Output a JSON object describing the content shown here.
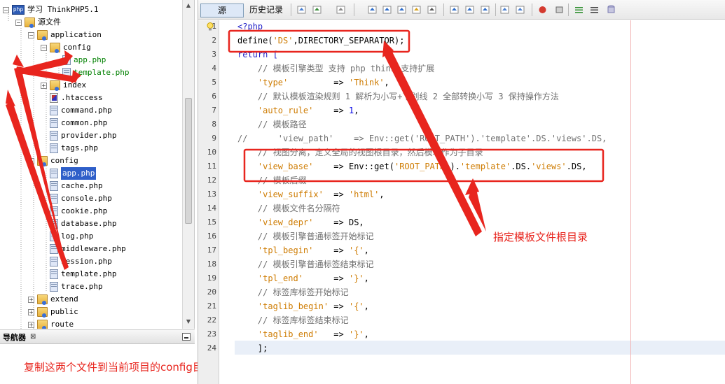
{
  "tree": {
    "project": "学习 ThinkPHP5.1",
    "project_icon": "php",
    "items": [
      {
        "label": "源文件",
        "kind": "folder",
        "level": 1
      },
      {
        "label": "application",
        "kind": "folder",
        "level": 2
      },
      {
        "label": "config",
        "kind": "folder",
        "level": 3
      },
      {
        "label": "app.php",
        "kind": "php",
        "level": 4,
        "green": true
      },
      {
        "label": "template.php",
        "kind": "php",
        "level": 4,
        "green": true
      },
      {
        "label": "index",
        "kind": "folder",
        "level": 3
      },
      {
        "label": ".htaccess",
        "kind": "htaccess",
        "level": 3
      },
      {
        "label": "command.php",
        "kind": "php",
        "level": 3
      },
      {
        "label": "common.php",
        "kind": "php",
        "level": 3
      },
      {
        "label": "provider.php",
        "kind": "php",
        "level": 3
      },
      {
        "label": "tags.php",
        "kind": "php",
        "level": 3
      },
      {
        "label": "config",
        "kind": "folder",
        "level": 2
      },
      {
        "label": "app.php",
        "kind": "php",
        "level": 3,
        "selected": true
      },
      {
        "label": "cache.php",
        "kind": "php",
        "level": 3
      },
      {
        "label": "console.php",
        "kind": "php",
        "level": 3
      },
      {
        "label": "cookie.php",
        "kind": "php",
        "level": 3
      },
      {
        "label": "database.php",
        "kind": "php",
        "level": 3
      },
      {
        "label": "log.php",
        "kind": "php",
        "level": 3
      },
      {
        "label": "middleware.php",
        "kind": "php",
        "level": 3
      },
      {
        "label": "session.php",
        "kind": "php",
        "level": 3
      },
      {
        "label": "template.php",
        "kind": "php",
        "level": 3
      },
      {
        "label": "trace.php",
        "kind": "php",
        "level": 3
      },
      {
        "label": "extend",
        "kind": "folder",
        "level": 2
      },
      {
        "label": "public",
        "kind": "folder",
        "level": 2
      },
      {
        "label": "route",
        "kind": "folder",
        "level": 2
      }
    ]
  },
  "navigator": {
    "title": "导航器",
    "close_glyph": "⊠"
  },
  "editor": {
    "tabs": [
      {
        "label": "源",
        "active": true
      },
      {
        "label": "历史记录",
        "active": false
      }
    ],
    "toolbar_icons": [
      "last-edit-icon",
      "back-icon",
      "forward-icon",
      "find-selection-icon",
      "find-previous-icon",
      "find-next-icon",
      "toggle-highlight-icon",
      "toggle-rect-select-icon",
      "previous-bookmark-icon",
      "next-bookmark-icon",
      "toggle-bookmark-icon",
      "shift-left-icon",
      "shift-right-icon",
      "start-macro-icon",
      "stop-macro-icon",
      "comment-icon",
      "uncomment-icon",
      "database-icon"
    ],
    "lines": [
      {
        "n": "1",
        "tokens": [
          {
            "t": "<?php",
            "c": "kw"
          }
        ]
      },
      {
        "n": "2",
        "tokens": [
          {
            "t": "define(",
            "c": ""
          },
          {
            "t": "'DS'",
            "c": "str"
          },
          {
            "t": ",DIRECTORY_SEPARATOR);",
            "c": ""
          }
        ]
      },
      {
        "n": "3",
        "tokens": [
          {
            "t": "return [",
            "c": "kw"
          }
        ]
      },
      {
        "n": "4",
        "tokens": [
          {
            "t": "    // 模板引擎类型 支持 php think 支持扩展",
            "c": "cm"
          }
        ]
      },
      {
        "n": "5",
        "tokens": [
          {
            "t": "    ",
            "c": ""
          },
          {
            "t": "'type'",
            "c": "str"
          },
          {
            "t": "         => ",
            "c": ""
          },
          {
            "t": "'Think'",
            "c": "str"
          },
          {
            "t": ",",
            "c": ""
          }
        ]
      },
      {
        "n": "6",
        "tokens": [
          {
            "t": "    // 默认模板渲染规则 1 解析为小写+下划线 2 全部转换小写 3 保持操作方法",
            "c": "cm"
          }
        ]
      },
      {
        "n": "7",
        "tokens": [
          {
            "t": "    ",
            "c": ""
          },
          {
            "t": "'auto_rule'",
            "c": "str"
          },
          {
            "t": "    => ",
            "c": ""
          },
          {
            "t": "1",
            "c": "num"
          },
          {
            "t": ",",
            "c": ""
          }
        ]
      },
      {
        "n": "8",
        "tokens": [
          {
            "t": "    // 模板路径",
            "c": "cm"
          }
        ]
      },
      {
        "n": "9",
        "tokens": [
          {
            "t": "//      'view_path'    => Env::get('ROOT_PATH').'template'.DS.'views'.DS,",
            "c": "cm"
          }
        ]
      },
      {
        "n": "10",
        "tokens": [
          {
            "t": "    // 视图分离，定义全局的视图根目录，然后模块作为子目录",
            "c": "cm"
          }
        ]
      },
      {
        "n": "11",
        "tokens": [
          {
            "t": "    ",
            "c": ""
          },
          {
            "t": "'view_base'",
            "c": "str"
          },
          {
            "t": "    => Env::get(",
            "c": ""
          },
          {
            "t": "'ROOT_PATH'",
            "c": "str"
          },
          {
            "t": ").",
            "c": ""
          },
          {
            "t": "'template'",
            "c": "str"
          },
          {
            "t": ".DS.",
            "c": ""
          },
          {
            "t": "'views'",
            "c": "str"
          },
          {
            "t": ".DS,",
            "c": ""
          }
        ]
      },
      {
        "n": "12",
        "tokens": [
          {
            "t": "    // 模板后缀",
            "c": "cm"
          }
        ]
      },
      {
        "n": "13",
        "tokens": [
          {
            "t": "    ",
            "c": ""
          },
          {
            "t": "'view_suffix'",
            "c": "str"
          },
          {
            "t": "  => ",
            "c": ""
          },
          {
            "t": "'html'",
            "c": "str"
          },
          {
            "t": ",",
            "c": ""
          }
        ]
      },
      {
        "n": "14",
        "tokens": [
          {
            "t": "    // 模板文件名分隔符",
            "c": "cm"
          }
        ]
      },
      {
        "n": "15",
        "tokens": [
          {
            "t": "    ",
            "c": ""
          },
          {
            "t": "'view_depr'",
            "c": "str"
          },
          {
            "t": "    => DS,",
            "c": ""
          }
        ]
      },
      {
        "n": "16",
        "tokens": [
          {
            "t": "    // 模板引擎普通标签开始标记",
            "c": "cm"
          }
        ]
      },
      {
        "n": "17",
        "tokens": [
          {
            "t": "    ",
            "c": ""
          },
          {
            "t": "'tpl_begin'",
            "c": "str"
          },
          {
            "t": "    => ",
            "c": ""
          },
          {
            "t": "'{'",
            "c": "str"
          },
          {
            "t": ",",
            "c": ""
          }
        ]
      },
      {
        "n": "18",
        "tokens": [
          {
            "t": "    // 模板引擎普通标签结束标记",
            "c": "cm"
          }
        ]
      },
      {
        "n": "19",
        "tokens": [
          {
            "t": "    ",
            "c": ""
          },
          {
            "t": "'tpl_end'",
            "c": "str"
          },
          {
            "t": "      => ",
            "c": ""
          },
          {
            "t": "'}'",
            "c": "str"
          },
          {
            "t": ",",
            "c": ""
          }
        ]
      },
      {
        "n": "20",
        "tokens": [
          {
            "t": "    // 标签库标签开始标记",
            "c": "cm"
          }
        ]
      },
      {
        "n": "21",
        "tokens": [
          {
            "t": "    ",
            "c": ""
          },
          {
            "t": "'taglib_begin'",
            "c": "str"
          },
          {
            "t": " => ",
            "c": ""
          },
          {
            "t": "'{'",
            "c": "str"
          },
          {
            "t": ",",
            "c": ""
          }
        ]
      },
      {
        "n": "22",
        "tokens": [
          {
            "t": "    // 标签库标签结束标记",
            "c": "cm"
          }
        ]
      },
      {
        "n": "23",
        "tokens": [
          {
            "t": "    ",
            "c": ""
          },
          {
            "t": "'taglib_end'",
            "c": "str"
          },
          {
            "t": "   => ",
            "c": ""
          },
          {
            "t": "'}'",
            "c": "str"
          },
          {
            "t": ",",
            "c": ""
          }
        ]
      },
      {
        "n": "24",
        "tokens": [
          {
            "t": "    ];",
            "c": ""
          }
        ]
      }
    ]
  },
  "annotations": {
    "template_root_note": "指定模板文件根目录",
    "copy_files_note": "复制这两个文件到当前项目的config目录下",
    "annotation_color": "#e8251e"
  }
}
